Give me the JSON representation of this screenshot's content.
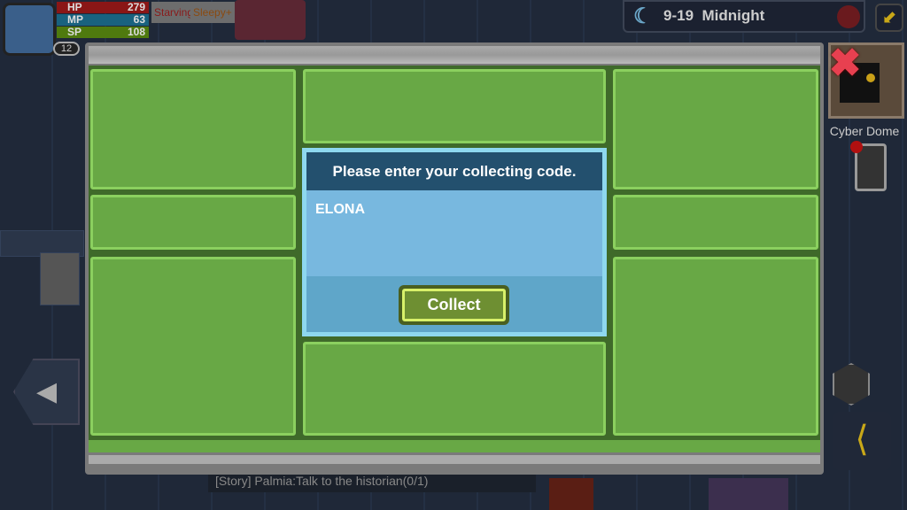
{
  "hud": {
    "hp_label": "HP",
    "hp": "279",
    "mp_label": "MP",
    "mp": "63",
    "sp_label": "SP",
    "sp": "108",
    "level": "12",
    "statuses": [
      "Starving",
      "Sleepy+"
    ]
  },
  "clock": {
    "date": "9-19",
    "time_of_day": "Midnight"
  },
  "minimap": {
    "location": "Cyber Dome"
  },
  "quest": {
    "text": "[Story] Palmia:Talk to the historian(0/1)"
  },
  "dialog": {
    "title": "Please enter your collecting code.",
    "code_value": "ELONA",
    "collect_label": "Collect"
  },
  "colors": {
    "hp": "#b01818",
    "mp": "#1a7fa8",
    "sp": "#6aa010",
    "panel_green": "#68a845",
    "dialog_blue": "#5fa6c9"
  }
}
